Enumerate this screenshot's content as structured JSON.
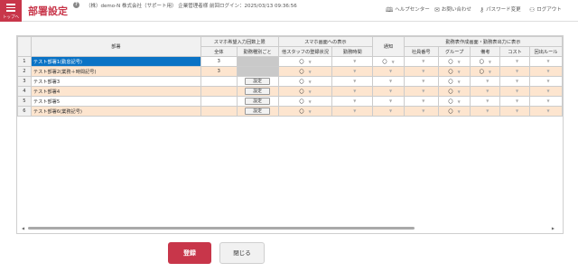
{
  "header": {
    "menu_label": "トップへ",
    "title": "部署設定",
    "help_mark": "?",
    "company_info": "（株）demo-N 株式会社（サポート用） 企業管理者様 前回ログイン：2025/03/13 09:36:56",
    "tools": [
      {
        "label": "ヘルプセンター",
        "icon": "book-icon",
        "glyph": "🕮"
      },
      {
        "label": "お問い合わせ",
        "icon": "mail-icon",
        "glyph": "✉"
      },
      {
        "label": "パスワード変更",
        "icon": "key-icon",
        "glyph": "⚷"
      },
      {
        "label": "ログアウト",
        "icon": "logout-icon",
        "glyph": "⚇"
      }
    ]
  },
  "table": {
    "col_dept": "部署",
    "group_smartphone_limit": "スマホ希望入力回数上限",
    "col_all": "全体",
    "col_by_type": "勤務種別ごと",
    "group_smartphone_display": "スマホ画面への表示",
    "col_other_staff": "他スタッフの登録状況",
    "col_work_hours": "勤務時間",
    "col_notify": "通知",
    "group_schedule_output": "勤務表作成画面・勤務表出力に表示",
    "col_employee_no": "社員番号",
    "col_group": "グループ",
    "col_remarks": "備考",
    "col_cost": "コスト",
    "col_rule": "回出ルール",
    "set_label": "設定",
    "check_mark": "〇",
    "rows": [
      {
        "num": "1",
        "name": "テスト部署1(勤怠記号)",
        "all": "3",
        "state": "sel"
      },
      {
        "num": "2",
        "name": "テスト部署2(業務＋時間記号)",
        "all": "3",
        "state": "alt"
      },
      {
        "num": "3",
        "name": "テスト部署3",
        "all": "",
        "state": ""
      },
      {
        "num": "4",
        "name": "テスト部署4",
        "all": "",
        "state": "alt"
      },
      {
        "num": "5",
        "name": "テスト部署5",
        "all": "",
        "state": ""
      },
      {
        "num": "6",
        "name": "テスト部署6(業務記号)",
        "all": "",
        "state": "alt"
      }
    ]
  },
  "actions": {
    "save_label": "登録",
    "close_label": "閉じる"
  },
  "colors": {
    "brand": "#c8364a",
    "selected_row": "#0b73c5",
    "alt_row": "#fde5cf"
  }
}
